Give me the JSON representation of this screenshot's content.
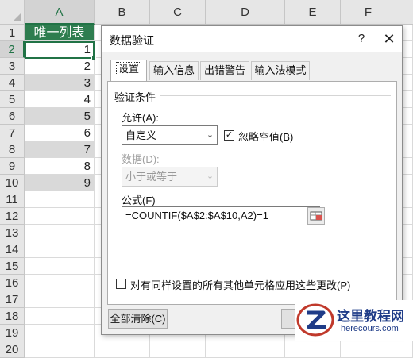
{
  "sheet": {
    "columns": [
      "A",
      "B",
      "C",
      "D",
      "E",
      "F"
    ],
    "rows": [
      "1",
      "2",
      "3",
      "4",
      "5",
      "6",
      "7",
      "8",
      "9",
      "10",
      "11",
      "12",
      "13",
      "14",
      "15",
      "16",
      "17",
      "18",
      "19",
      "20"
    ],
    "header_cell": "唯一列表",
    "values": [
      "1",
      "2",
      "3",
      "4",
      "5",
      "6",
      "7",
      "8",
      "9"
    ],
    "colors": {
      "header_fill": "#2e7d4f",
      "grey_fill": "#d9d9d9",
      "selection": "#217346"
    }
  },
  "dialog": {
    "title": "数据验证",
    "help": "?",
    "close": "✕",
    "tabs": [
      "设置",
      "输入信息",
      "出错警告",
      "输入法模式"
    ],
    "section": "验证条件",
    "allow_label": "允许(A):",
    "allow_value": "自定义",
    "ignore_blank_label": "忽略空值(B)",
    "ignore_blank_checked": true,
    "data_label": "数据(D):",
    "data_value": "小于或等于",
    "formula_label": "公式(F)",
    "formula_value": "=COUNTIF($A$2:$A$10,A2)=1",
    "apply_all_label": "对有同样设置的所有其他单元格应用这些更改(P)",
    "apply_all_checked": false,
    "clear_all": "全部清除(C)"
  },
  "watermark": {
    "title": "这里教程网",
    "url": "herecours.com"
  }
}
